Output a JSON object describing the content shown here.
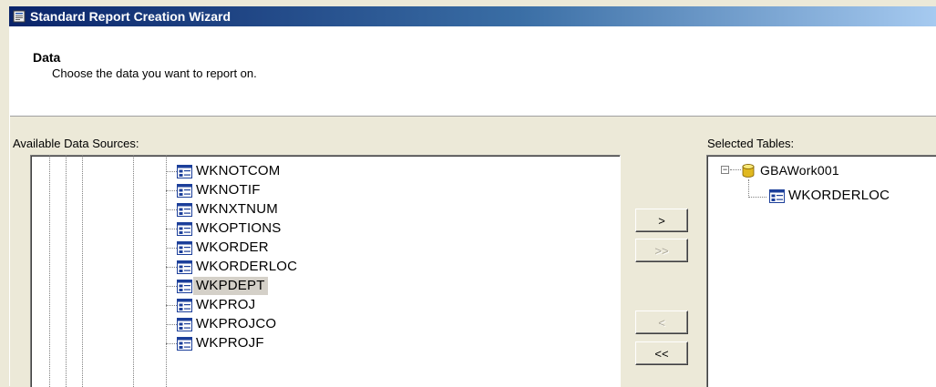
{
  "window": {
    "title": "Standard Report Creation Wizard"
  },
  "header": {
    "title": "Data",
    "subtitle": "Choose the data you want to report on."
  },
  "available": {
    "label": "Available Data Sources:",
    "items": [
      "WKNOTCOM",
      "WKNOTIF",
      "WKNXTNUM",
      "WKOPTIONS",
      "WKORDER",
      "WKORDERLOC",
      "WKPDEPT",
      "WKPROJ",
      "WKPROJCO",
      "WKPROJF"
    ],
    "selected_index": 6
  },
  "buttons": {
    "add": ">",
    "add_all": ">>",
    "remove": "<",
    "remove_all": "<<"
  },
  "selected": {
    "label": "Selected Tables:",
    "root": {
      "name": "GBAWork001",
      "expander": "−"
    },
    "items": [
      "WKORDERLOC"
    ]
  },
  "icons": {
    "app": "wizard-icon",
    "table": "table-icon",
    "database": "database-icon"
  },
  "colors": {
    "title_start": "#0a246a",
    "title_end": "#a6caf0",
    "dialog_bg": "#ece9d8",
    "selection_bg": "#d4d0c8"
  }
}
